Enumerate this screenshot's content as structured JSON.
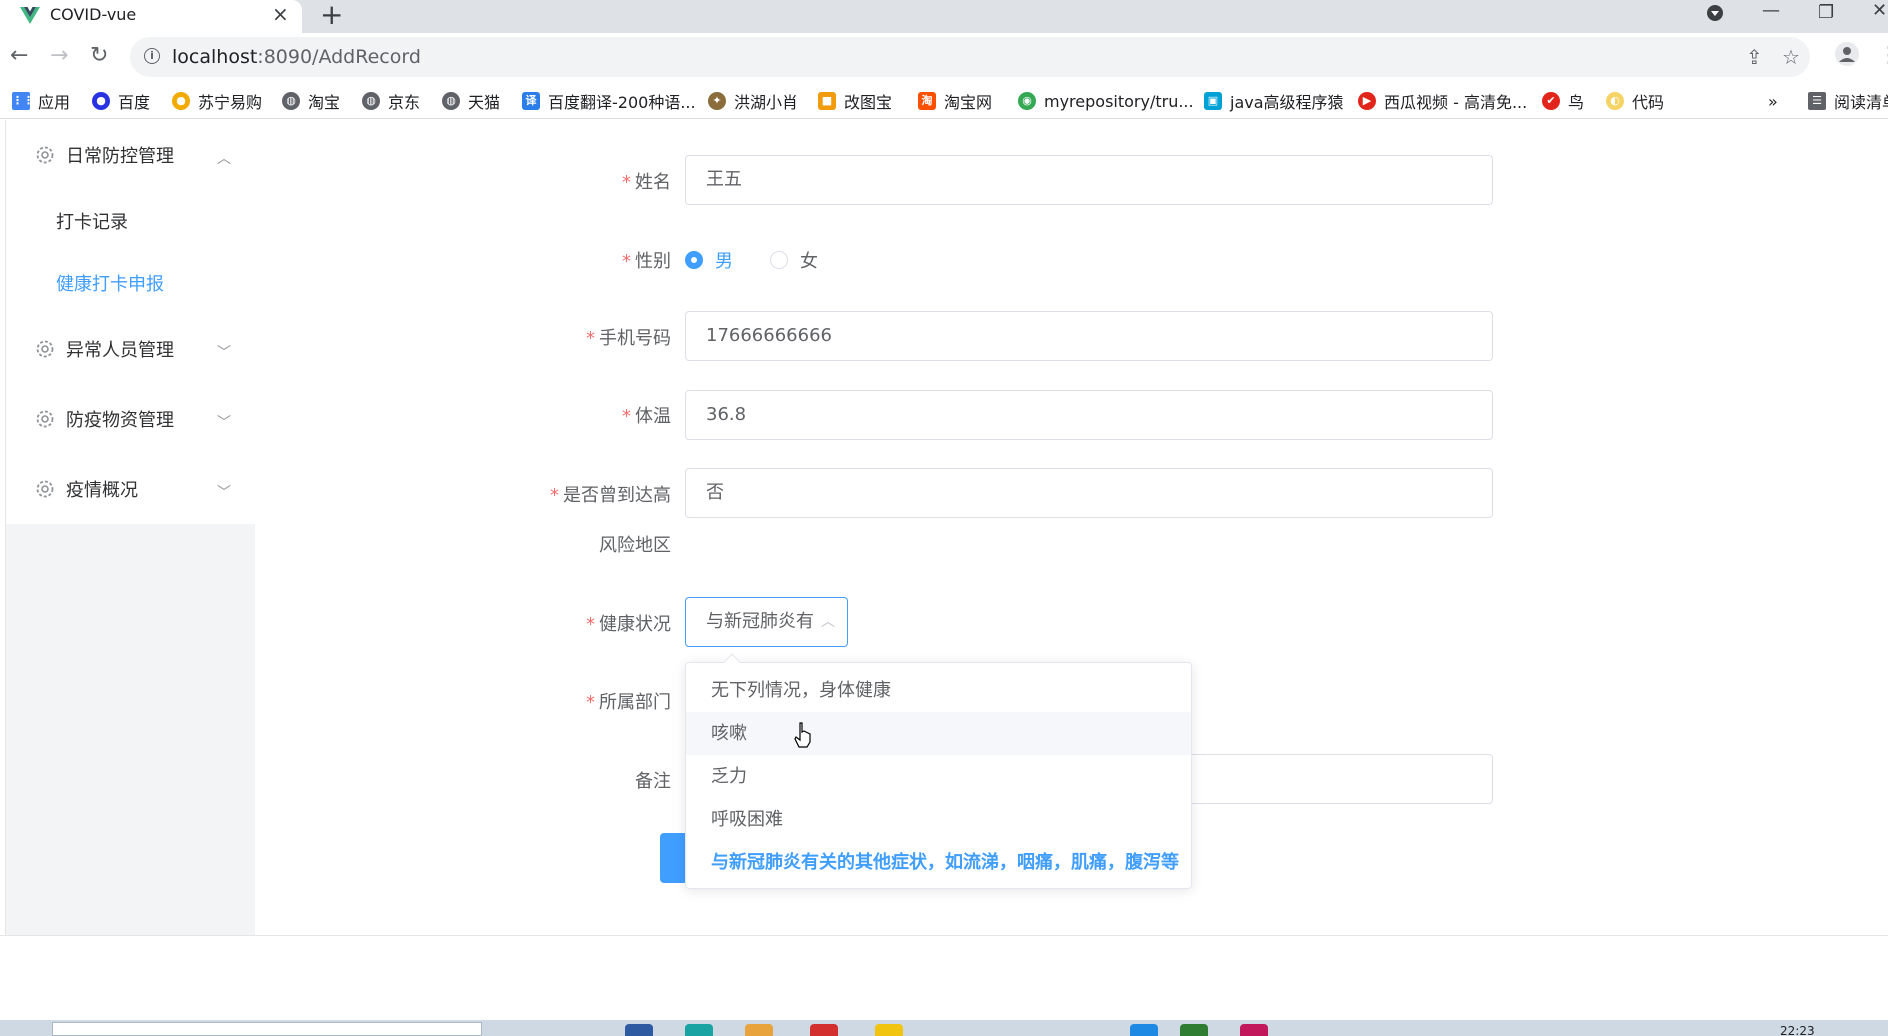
{
  "browser": {
    "tab_title": "COVID-vue",
    "url_host": "localhost",
    "url_path": ":8090/AddRecord",
    "bookmarks": [
      {
        "label": "应用",
        "icon": "apps-grid-icon",
        "color": "#4285f4"
      },
      {
        "label": "百度",
        "icon": "baidu-paw-icon",
        "color": "#2932e1"
      },
      {
        "label": "苏宁易购",
        "icon": "suning-icon",
        "color": "#f2a900"
      },
      {
        "label": "淘宝",
        "icon": "globe-icon",
        "color": "#5f6368"
      },
      {
        "label": "京东",
        "icon": "globe-icon",
        "color": "#5f6368"
      },
      {
        "label": "天猫",
        "icon": "globe-icon",
        "color": "#5f6368"
      },
      {
        "label": "百度翻译-200种语...",
        "icon": "translate-icon",
        "color": "#2b7de9"
      },
      {
        "label": "洪湖小肖",
        "icon": "bird-icon",
        "color": "#8a6d3b"
      },
      {
        "label": "改图宝",
        "icon": "image-edit-icon",
        "color": "#f29b0c"
      },
      {
        "label": "淘宝网",
        "icon": "taobao-icon",
        "color": "#ff5000"
      },
      {
        "label": "myrepository/tru...",
        "icon": "chrome-icon",
        "color": "#34a853"
      },
      {
        "label": "java高级程序猿",
        "icon": "bilibili-icon",
        "color": "#00a1d6"
      },
      {
        "label": "西瓜视频 - 高清免...",
        "icon": "play-icon",
        "color": "#e1251b"
      },
      {
        "label": "鸟",
        "icon": "bird-icon",
        "color": "#e1251b"
      },
      {
        "label": "代码",
        "icon": "bulb-icon",
        "color": "#f6d365"
      }
    ],
    "overflow": "»",
    "reading_list": "阅读清单"
  },
  "sidebar": {
    "groups": [
      {
        "label": "日常防控管理",
        "expanded": true,
        "items": [
          {
            "label": "打卡记录",
            "active": false
          },
          {
            "label": "健康打卡申报",
            "active": true
          }
        ]
      },
      {
        "label": "异常人员管理",
        "expanded": false,
        "items": []
      },
      {
        "label": "防疫物资管理",
        "expanded": false,
        "items": []
      },
      {
        "label": "疫情概况",
        "expanded": false,
        "items": []
      }
    ]
  },
  "form": {
    "required_mark": "*",
    "name": {
      "label": "姓名",
      "value": "王五"
    },
    "gender": {
      "label": "性别",
      "options": [
        "男",
        "女"
      ],
      "selected": "男"
    },
    "phone": {
      "label": "手机号码",
      "value": "17666666666"
    },
    "temperature": {
      "label": "体温",
      "value": "36.8"
    },
    "risk_area": {
      "label_line1": "是否曾到达高",
      "label_line2": "风险地区",
      "value": "否"
    },
    "health": {
      "label": "健康状况",
      "value": "与新冠肺炎有"
    },
    "department": {
      "label": "所属部门"
    },
    "remark": {
      "label": "备注"
    }
  },
  "dropdown": {
    "options": [
      {
        "label": "无下列情况，身体健康",
        "state": "normal"
      },
      {
        "label": "咳嗽",
        "state": "hover"
      },
      {
        "label": "乏力",
        "state": "normal"
      },
      {
        "label": "呼吸困难",
        "state": "normal"
      },
      {
        "label": "与新冠肺炎有关的其他症状，如流涕，咽痛，肌痛，腹泻等",
        "state": "selected"
      }
    ]
  },
  "taskbar": {
    "time": "22:23"
  },
  "colors": {
    "accent": "#409eff",
    "required": "#f56c6c",
    "label": "#606266"
  }
}
